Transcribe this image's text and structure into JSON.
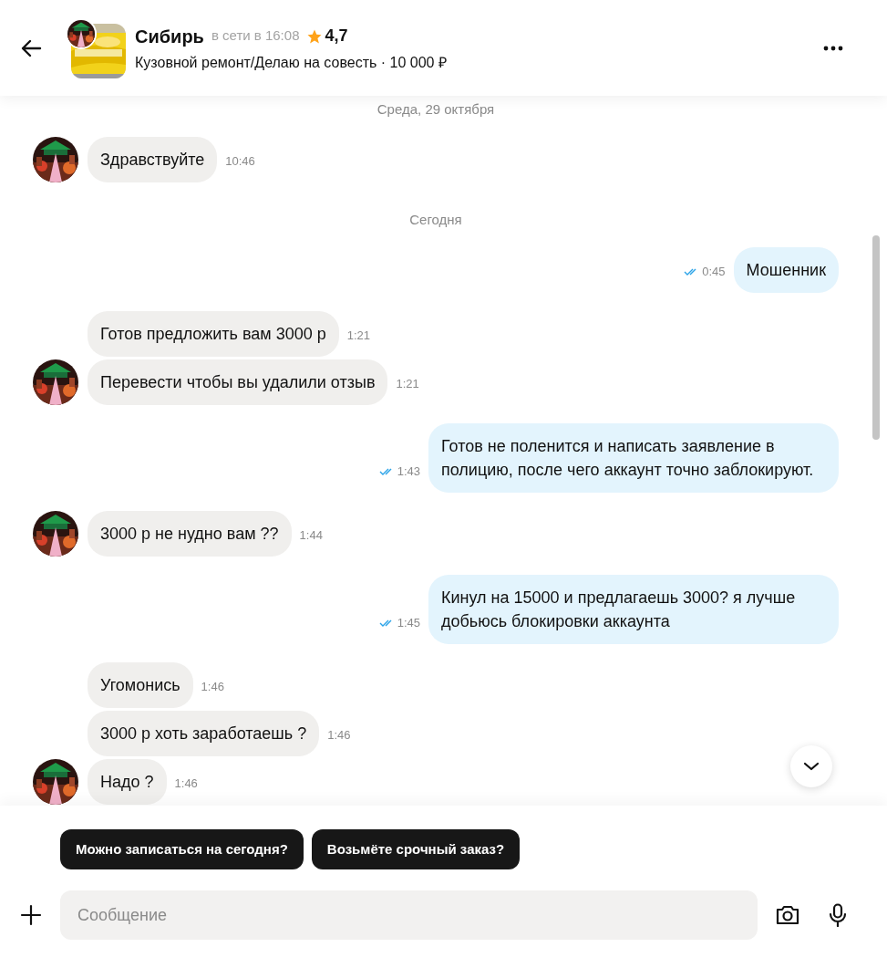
{
  "header": {
    "title": "Сибирь",
    "status": "в сети в 16:08",
    "rating": "4,7",
    "subtitle": "Кузовной ремонт/Делаю на совесть · 10 000 ₽"
  },
  "messages": [
    {
      "kind": "date",
      "text": "Среда, 29 октября"
    },
    {
      "kind": "in",
      "text": "Здравствуйте",
      "time": "10:46",
      "avatar": true
    },
    {
      "kind": "date",
      "text": "Сегодня"
    },
    {
      "kind": "out",
      "text": "Мошенник",
      "time": "0:45",
      "read": true
    },
    {
      "kind": "in",
      "text": "Готов предложить вам 3000 р",
      "time": "1:21",
      "avatar": false
    },
    {
      "kind": "in",
      "text": "Перевести чтобы вы удалили отзыв",
      "time": "1:21",
      "avatar": true
    },
    {
      "kind": "out",
      "text": "Готов не поленится и написать заявление в полицию, после чего аккаунт точно заблокируют.",
      "time": "1:43",
      "read": true
    },
    {
      "kind": "in",
      "text": "3000 р не нудно вам ??",
      "time": "1:44",
      "avatar": true
    },
    {
      "kind": "out",
      "text": "Кинул на 15000 и предлагаешь 3000? я лучше добьюсь блокировки аккаунта",
      "time": "1:45",
      "read": true
    },
    {
      "kind": "in",
      "text": "Угомонись",
      "time": "1:46",
      "avatar": false
    },
    {
      "kind": "in",
      "text": "3000 р хоть заработаешь ?",
      "time": "1:46",
      "avatar": false
    },
    {
      "kind": "in",
      "text": "Надо ?",
      "time": "1:46",
      "avatar": true
    }
  ],
  "quick_replies": [
    "Можно записаться на сегодня?",
    "Возьмёте срочный заказ?"
  ],
  "composer": {
    "placeholder": "Сообщение"
  }
}
